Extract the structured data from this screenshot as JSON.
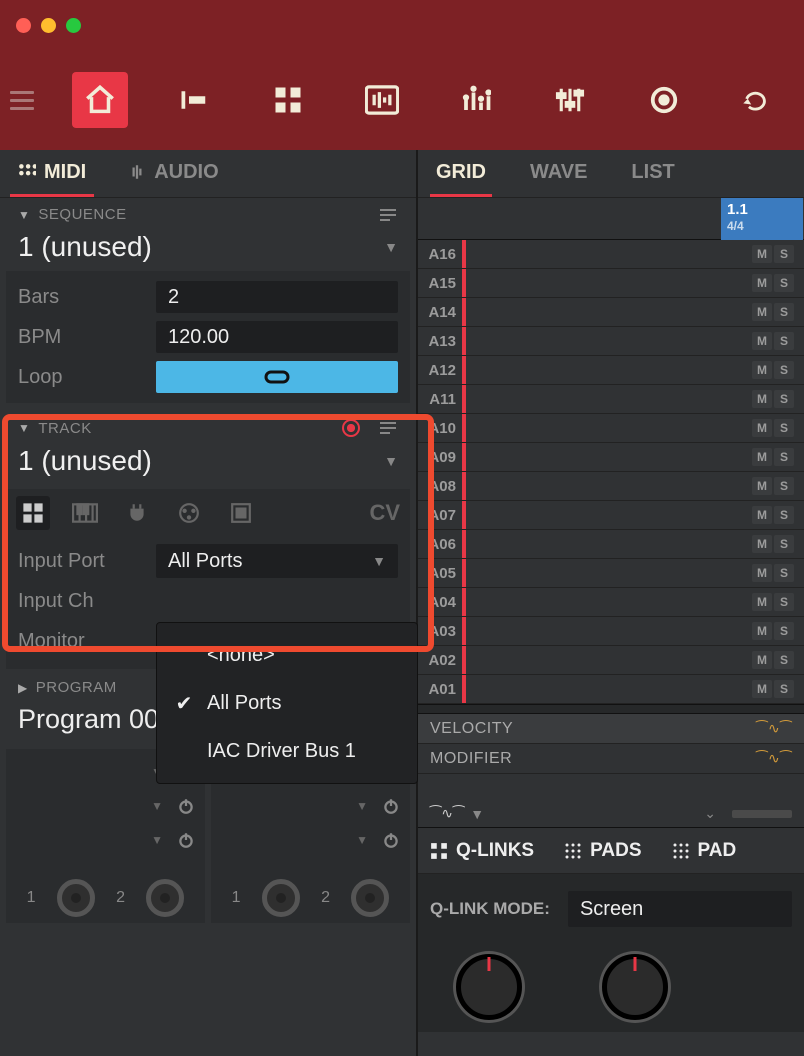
{
  "window": {
    "close_color": "#ff5f56",
    "min_color": "#ffbd2e",
    "max_color": "#27c93f"
  },
  "left_tabs": {
    "midi": "MIDI",
    "audio": "AUDIO"
  },
  "sequence": {
    "header": "SEQUENCE",
    "name": "1 (unused)",
    "bars_label": "Bars",
    "bars_value": "2",
    "bpm_label": "BPM",
    "bpm_value": "120.00",
    "loop_label": "Loop"
  },
  "track": {
    "header": "TRACK",
    "name": "1 (unused)",
    "cv_label": "CV",
    "input_port_label": "Input Port",
    "input_port_value": "All Ports",
    "input_ch_label": "Input Ch",
    "monitor_label": "Monitor"
  },
  "input_port_menu": {
    "items": [
      {
        "label": "<none>",
        "checked": false
      },
      {
        "label": "All Ports",
        "checked": true
      },
      {
        "label": "IAC Driver Bus 1",
        "checked": false
      }
    ]
  },
  "program": {
    "header": "PROGRAM",
    "name": "Program 001"
  },
  "knob_cards": {
    "card1": {
      "n1": "1",
      "n2": "2"
    },
    "card2": {
      "n1": "1",
      "n2": "2"
    }
  },
  "right_tabs": {
    "grid": "GRID",
    "wave": "WAVE",
    "list": "LIST"
  },
  "ruler": {
    "pos": "1.1",
    "sig": "4/4"
  },
  "grid_tracks": [
    "A16",
    "A15",
    "A14",
    "A13",
    "A12",
    "A11",
    "A10",
    "A09",
    "A08",
    "A07",
    "A06",
    "A05",
    "A04",
    "A03",
    "A02",
    "A01"
  ],
  "ms": {
    "m": "M",
    "s": "S"
  },
  "lanes": {
    "velocity": "VELOCITY",
    "modifier": "MODIFIER"
  },
  "qlinks": {
    "tab1": "Q-LINKS",
    "tab2": "PADS",
    "tab3": "PAD",
    "mode_label": "Q-LINK MODE:",
    "mode_value": "Screen"
  }
}
